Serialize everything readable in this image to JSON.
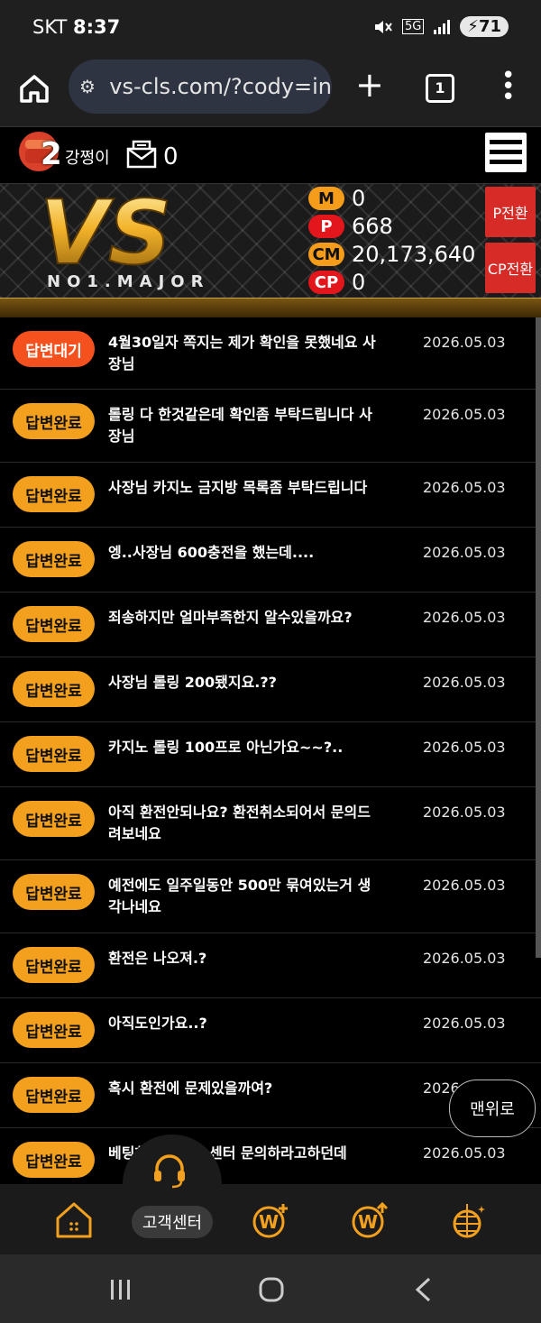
{
  "status_bar": {
    "carrier": "SKT",
    "time": "8:37",
    "network": "5G",
    "battery": "71"
  },
  "browser": {
    "url": "vs-cls.com/?cody=in",
    "tab_count": "1"
  },
  "header": {
    "level": "2",
    "username": "강쩡이",
    "message_count": "0"
  },
  "banner": {
    "logo_text": "VS",
    "logo_subtitle": "NO1.MAJOR",
    "stats": [
      {
        "label": "M",
        "value": "0"
      },
      {
        "label": "P",
        "value": "668"
      },
      {
        "label": "CM",
        "value": "20,173,640"
      },
      {
        "label": "CP",
        "value": "0"
      }
    ],
    "p_convert": "P전환",
    "cp_convert": "CP전환"
  },
  "inquiries": [
    {
      "status": "답변대기",
      "title": "4월30일자 쪽지는 제가 확인을 못했네요 사장님",
      "date": "2026.05.03"
    },
    {
      "status": "답변완료",
      "title": "롤링 다 한것같은데 확인좀 부탁드립니다 사장님",
      "date": "2026.05.03"
    },
    {
      "status": "답변완료",
      "title": "사장님 카지노 금지방 목록좀 부탁드립니다",
      "date": "2026.05.03"
    },
    {
      "status": "답변완료",
      "title": "엥..사장님 600충전을 했는데....",
      "date": "2026.05.03"
    },
    {
      "status": "답변완료",
      "title": "죄송하지만 얼마부족한지 알수있을까요?",
      "date": "2026.05.03"
    },
    {
      "status": "답변완료",
      "title": "사장님 롤링 200됐지요.??",
      "date": "2026.05.03"
    },
    {
      "status": "답변완료",
      "title": "카지노 롤링 100프로 아닌가요~~?..",
      "date": "2026.05.03"
    },
    {
      "status": "답변완료",
      "title": "아직 환전안되나요? 환전취소되어서 문의드려보네요",
      "date": "2026.05.03"
    },
    {
      "status": "답변완료",
      "title": "예전에도 일주일동안 500만 묶여있는거 생각나네요",
      "date": "2026.05.03"
    },
    {
      "status": "답변완료",
      "title": "환전은 나오져.?",
      "date": "2026.05.03"
    },
    {
      "status": "답변완료",
      "title": "아직도인가요..?",
      "date": "2026.05.03"
    },
    {
      "status": "답변완료",
      "title": "혹시 환전에 문제있을까여?",
      "date": "2026.0"
    },
    {
      "status": "답변완료",
      "title": "베팅하",
      "title_tail": "센터 문의하라고하던데",
      "date": "2026.05.03"
    }
  ],
  "top_button": "맨위로",
  "bottom_nav": {
    "center_label": "고객센터"
  },
  "colors": {
    "accent_orange": "#f2a01d",
    "waiting_red": "#f4511e",
    "stat_red": "#e3161c",
    "convert_red": "#d62b27"
  }
}
